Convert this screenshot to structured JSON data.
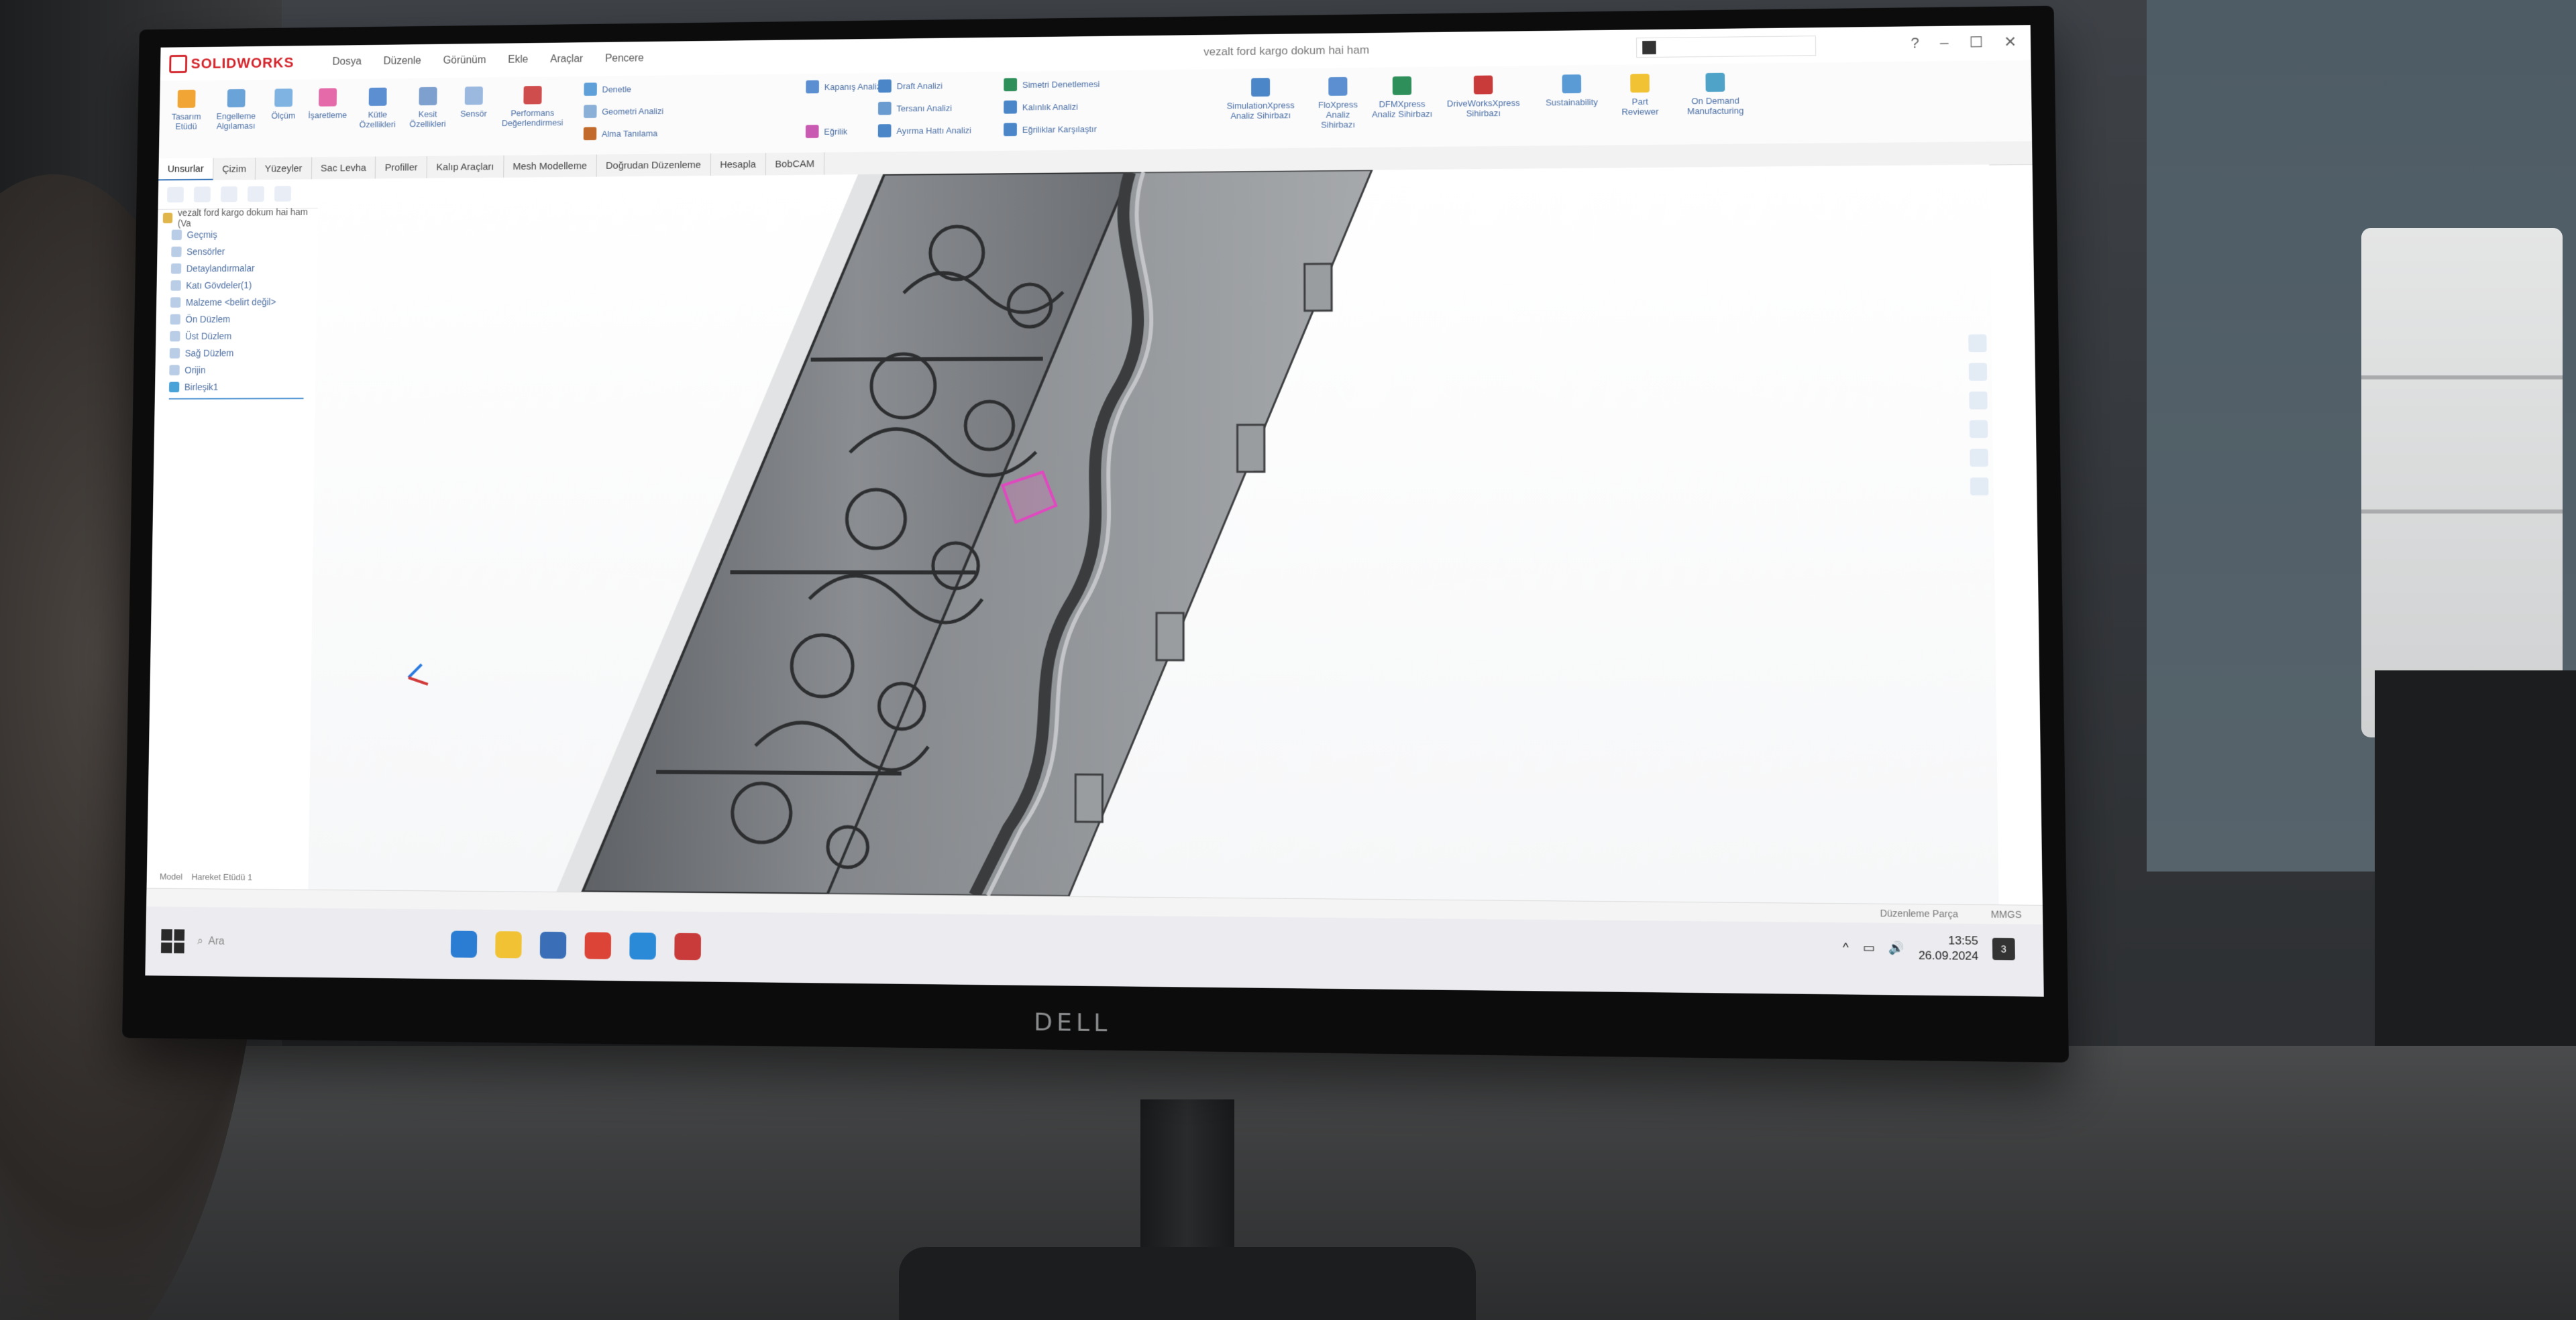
{
  "app": {
    "brand": "SOLIDWORKS",
    "document_title": "vezalt ford kargo dokum hai ham",
    "search_placeholder": "",
    "window_controls": [
      "?",
      "–",
      "☐",
      "✕"
    ]
  },
  "menu": [
    "Dosya",
    "Düzenle",
    "Görünüm",
    "Ekle",
    "Araçlar",
    "Pencere"
  ],
  "ribbon": {
    "large_buttons": [
      {
        "label": "Tasarım Etüdü",
        "color": "#f0a534"
      },
      {
        "label": "Engelleme Algılaması",
        "color": "#6aa3d8"
      },
      {
        "label": "Ölçüm",
        "color": "#7fb3e2"
      },
      {
        "label": "İşaretleme",
        "color": "#e46aa9"
      },
      {
        "label": "Kütle Özellikleri",
        "color": "#5b8fd1"
      },
      {
        "label": "Kesit Özellikleri",
        "color": "#7ea0cf"
      },
      {
        "label": "Sensör",
        "color": "#9bb9df"
      },
      {
        "label": "Performans Değerlendirmesi",
        "color": "#d04d4d"
      }
    ],
    "small_rows": [
      {
        "label": "Denetle",
        "color": "#5fa0d8"
      },
      {
        "label": "Geometri Analizi",
        "color": "#8ab0d8"
      },
      {
        "label": "Alma Tanılama",
        "color": "#c26a2b"
      },
      {
        "label": "Kapanış Analizi",
        "color": "#5b8fd1"
      },
      {
        "label": "Eğrilik",
        "color": "#c95ab1"
      },
      {
        "label": "Draft Analizi",
        "color": "#4a86c8"
      },
      {
        "label": "Tersanı Analizi",
        "color": "#6a9bd0"
      },
      {
        "label": "Ayırma Hattı Analizi",
        "color": "#4a86c8"
      },
      {
        "label": "Simetri Denetlemesi",
        "color": "#2f8f5b"
      },
      {
        "label": "Kalınlık Analizi",
        "color": "#4a86c8"
      },
      {
        "label": "Eğriliklar Karşılaştır",
        "color": "#4a86c8"
      }
    ],
    "right_buttons": [
      {
        "label": "SimulationXpress Analiz Sihirbazı",
        "color": "#4a86c8"
      },
      {
        "label": "FloXpress Analiz Sihirbazı",
        "color": "#5b8fd1"
      },
      {
        "label": "DFMXpress Analiz Sihirbazı",
        "color": "#2f8f5b"
      },
      {
        "label": "DriveWorksXpress Sihirbazı",
        "color": "#c93a3a"
      },
      {
        "label": "Sustainability",
        "color": "#5b9bd5"
      },
      {
        "label": "Part Reviewer",
        "color": "#f0c234"
      },
      {
        "label": "On Demand Manufacturing",
        "color": "#4fa3c8"
      }
    ]
  },
  "command_tabs": [
    "Unsurlar",
    "Çizim",
    "Yüzeyler",
    "Sac Levha",
    "Profiller",
    "Kalıp Araçları",
    "Mesh Modelleme",
    "Doğrudan Düzenleme",
    "Hesapla",
    "BobCAM"
  ],
  "active_tab_index": 0,
  "tree": {
    "root": "vezalt ford kargo dokum hai ham (Va",
    "items": [
      "Geçmiş",
      "Sensörler",
      "Detaylandırmalar",
      "Katı Gövdeler(1)",
      "Malzeme <belirt değil>",
      "Ön Düzlem",
      "Üst Düzlem",
      "Sağ Düzlem",
      "Orijin",
      "Birleşik1"
    ]
  },
  "bottom_tabs": [
    "Model",
    "Hareket Etüdü 1"
  ],
  "status": {
    "mode": "Düzenleme Parça",
    "units": "MMGS"
  },
  "taskbar": {
    "search_label": "Ara",
    "apps": [
      {
        "name": "edge",
        "color": "#2b7cd3"
      },
      {
        "name": "explorer",
        "color": "#f0c234"
      },
      {
        "name": "app",
        "color": "#3a6fb8"
      },
      {
        "name": "chrome",
        "color": "#db4437"
      },
      {
        "name": "app2",
        "color": "#2b8ad8"
      },
      {
        "name": "solidworks",
        "color": "#c93a3a"
      }
    ],
    "time": "13:55",
    "date": "26.09.2024",
    "notifications": "3"
  },
  "monitor_brand": "DELL"
}
